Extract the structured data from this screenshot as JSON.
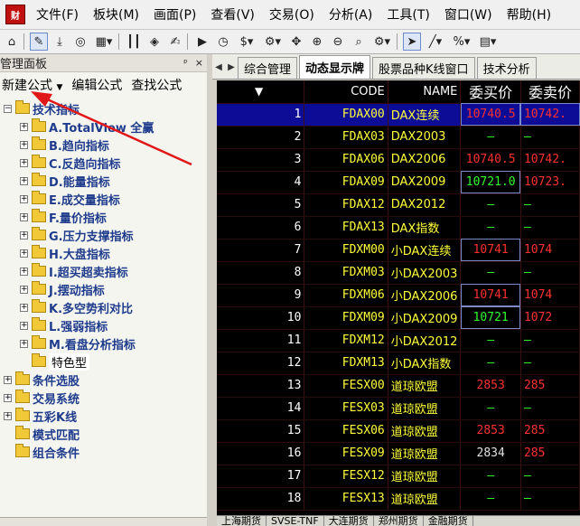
{
  "menubar": {
    "logo_text": "财",
    "items": [
      {
        "label": "文件(F)"
      },
      {
        "label": "板块(M)"
      },
      {
        "label": "画面(P)"
      },
      {
        "label": "查看(V)"
      },
      {
        "label": "交易(O)"
      },
      {
        "label": "分析(A)"
      },
      {
        "label": "工具(T)"
      },
      {
        "label": "窗口(W)"
      },
      {
        "label": "帮助(H)"
      }
    ]
  },
  "toolbar": {
    "icons": [
      "home-icon",
      "pin-icon",
      "download-icon",
      "globe-icon",
      "grid-icon",
      "candlestick-icon",
      "diamond-icon",
      "edit-icon",
      "play-icon",
      "clock-icon",
      "dollar-icon",
      "settings-icon",
      "move-icon",
      "zoom-in-icon",
      "zoom-out-icon",
      "search-icon",
      "gear-icon",
      "cursor-icon",
      "line-icon",
      "percent-icon",
      "table-icon"
    ]
  },
  "panel": {
    "title": "管理面板",
    "pin_glyph": "ᵖ",
    "close_glyph": "×",
    "actions": {
      "new_formula": "新建公式",
      "edit_formula": "编辑公式",
      "find_formula": "查找公式"
    },
    "tree": {
      "root": "技术指标",
      "children": [
        "A.TotalView 全赢",
        "B.趋向指标",
        "C.反趋向指标",
        "D.能量指标",
        "E.成交量指标",
        "F.量价指标",
        "G.压力支撑指标",
        "H.大盘指标",
        "I.超买超卖指标",
        "J.摆动指标",
        "K.多空势利对比",
        "L.强弱指标",
        "M.看盘分析指标"
      ],
      "special": "特色型",
      "others": [
        "条件选股",
        "交易系统",
        "五彩K线"
      ],
      "leaves": [
        "模式匹配",
        "组合条件"
      ]
    }
  },
  "tabs": [
    {
      "label": "综合管理"
    },
    {
      "label": "动态显示牌"
    },
    {
      "label": "股票品种K线窗口"
    },
    {
      "label": "技术分析"
    }
  ],
  "grid": {
    "headers": {
      "sort": "▼",
      "code": "CODE",
      "name": "NAME",
      "bid": "委买价",
      "ask": "委卖价"
    },
    "rows": [
      {
        "no": "1",
        "code": "FDAX00",
        "name": "DAX连续",
        "bid": "10740.5",
        "ask": "10742.",
        "bid_c": "red",
        "ask_c": "red"
      },
      {
        "no": "2",
        "code": "FDAX03",
        "name": "DAX2003",
        "bid": "—",
        "ask": "—",
        "bid_c": "dash",
        "ask_c": "dash"
      },
      {
        "no": "3",
        "code": "FDAX06",
        "name": "DAX2006",
        "bid": "10740.5",
        "ask": "10742.",
        "bid_c": "red",
        "ask_c": "red"
      },
      {
        "no": "4",
        "code": "FDAX09",
        "name": "DAX2009",
        "bid": "10721.0",
        "ask": "10723.",
        "bid_c": "green",
        "ask_c": "red"
      },
      {
        "no": "5",
        "code": "FDAX12",
        "name": "DAX2012",
        "bid": "—",
        "ask": "—",
        "bid_c": "dash",
        "ask_c": "dash"
      },
      {
        "no": "6",
        "code": "FDAX13",
        "name": "DAX指数",
        "bid": "—",
        "ask": "—",
        "bid_c": "dash",
        "ask_c": "dash"
      },
      {
        "no": "7",
        "code": "FDXM00",
        "name": "小DAX连续",
        "bid": "10741",
        "ask": "1074",
        "bid_c": "red",
        "ask_c": "red"
      },
      {
        "no": "8",
        "code": "FDXM03",
        "name": "小DAX2003",
        "bid": "—",
        "ask": "—",
        "bid_c": "dash",
        "ask_c": "dash"
      },
      {
        "no": "9",
        "code": "FDXM06",
        "name": "小DAX2006",
        "bid": "10741",
        "ask": "1074",
        "bid_c": "red",
        "ask_c": "red"
      },
      {
        "no": "10",
        "code": "FDXM09",
        "name": "小DAX2009",
        "bid": "10721",
        "ask": "1072",
        "bid_c": "green",
        "ask_c": "red"
      },
      {
        "no": "11",
        "code": "FDXM12",
        "name": "小DAX2012",
        "bid": "—",
        "ask": "—",
        "bid_c": "dash",
        "ask_c": "dash"
      },
      {
        "no": "12",
        "code": "FDXM13",
        "name": "小DAX指数",
        "bid": "—",
        "ask": "—",
        "bid_c": "dash",
        "ask_c": "dash"
      },
      {
        "no": "13",
        "code": "FESX00",
        "name": "道琼欧盟",
        "bid": "2853",
        "ask": "285",
        "bid_c": "red",
        "ask_c": "red"
      },
      {
        "no": "14",
        "code": "FESX03",
        "name": "道琼欧盟",
        "bid": "—",
        "ask": "—",
        "bid_c": "dash",
        "ask_c": "dash"
      },
      {
        "no": "15",
        "code": "FESX06",
        "name": "道琼欧盟",
        "bid": "2853",
        "ask": "285",
        "bid_c": "red",
        "ask_c": "red"
      },
      {
        "no": "16",
        "code": "FESX09",
        "name": "道琼欧盟",
        "bid": "2834",
        "ask": "285",
        "bid_c": "white",
        "ask_c": "red"
      },
      {
        "no": "17",
        "code": "FESX12",
        "name": "道琼欧盟",
        "bid": "—",
        "ask": "—",
        "bid_c": "dash",
        "ask_c": "dash"
      },
      {
        "no": "18",
        "code": "FESX13",
        "name": "道琼欧盟",
        "bid": "—",
        "ask": "—",
        "bid_c": "dash",
        "ask_c": "dash"
      }
    ]
  },
  "bottom_tabs": [
    "上海期货",
    "SVSE-TNF",
    "大连期货",
    "郑州期货",
    "金融期货"
  ],
  "colors": {
    "accent_red": "#e01818",
    "grid_bg": "#000000",
    "code_yellow": "#ffff3a",
    "selected_row": "#0c0c96"
  }
}
